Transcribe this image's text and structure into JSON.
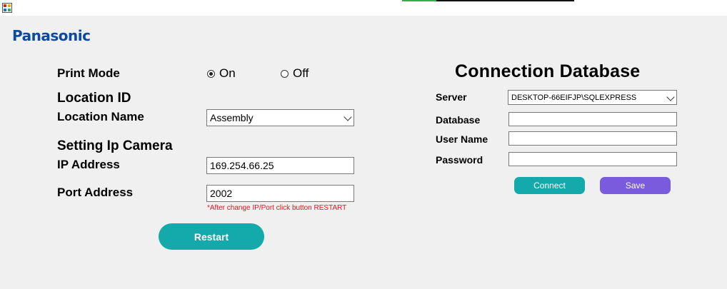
{
  "app": {
    "brand": "Panasonic",
    "icon": "app-window-icon"
  },
  "title_progress": {
    "value": 0.2
  },
  "left": {
    "print_mode": {
      "label": "Print Mode",
      "options": [
        {
          "label": "On",
          "checked": true
        },
        {
          "label": "Off",
          "checked": false
        }
      ]
    },
    "location_id_label": "Location ID",
    "location_name": {
      "label": "Location Name",
      "value": "Assembly"
    },
    "camera_section": "Setting Ip Camera",
    "ip_address": {
      "label": "IP Address",
      "value": "169.254.66.25"
    },
    "port_address": {
      "label": "Port Address",
      "value": "2002"
    },
    "note": "*After change IP/Port click button RESTART",
    "restart_label": "Restart"
  },
  "right": {
    "heading": "Connection Database",
    "server": {
      "label": "Server",
      "value": "DESKTOP-66EIFJP\\SQLEXPRESS"
    },
    "database": {
      "label": "Database",
      "value": ""
    },
    "user_name": {
      "label": "User Name",
      "value": ""
    },
    "password": {
      "label": "Password",
      "value": ""
    },
    "connect_label": "Connect",
    "save_label": "Save"
  },
  "colors": {
    "brand": "#0b4aa2",
    "teal_button": "#14a9ab",
    "purple_button": "#7a5bde",
    "warning_text": "#e4141e"
  }
}
